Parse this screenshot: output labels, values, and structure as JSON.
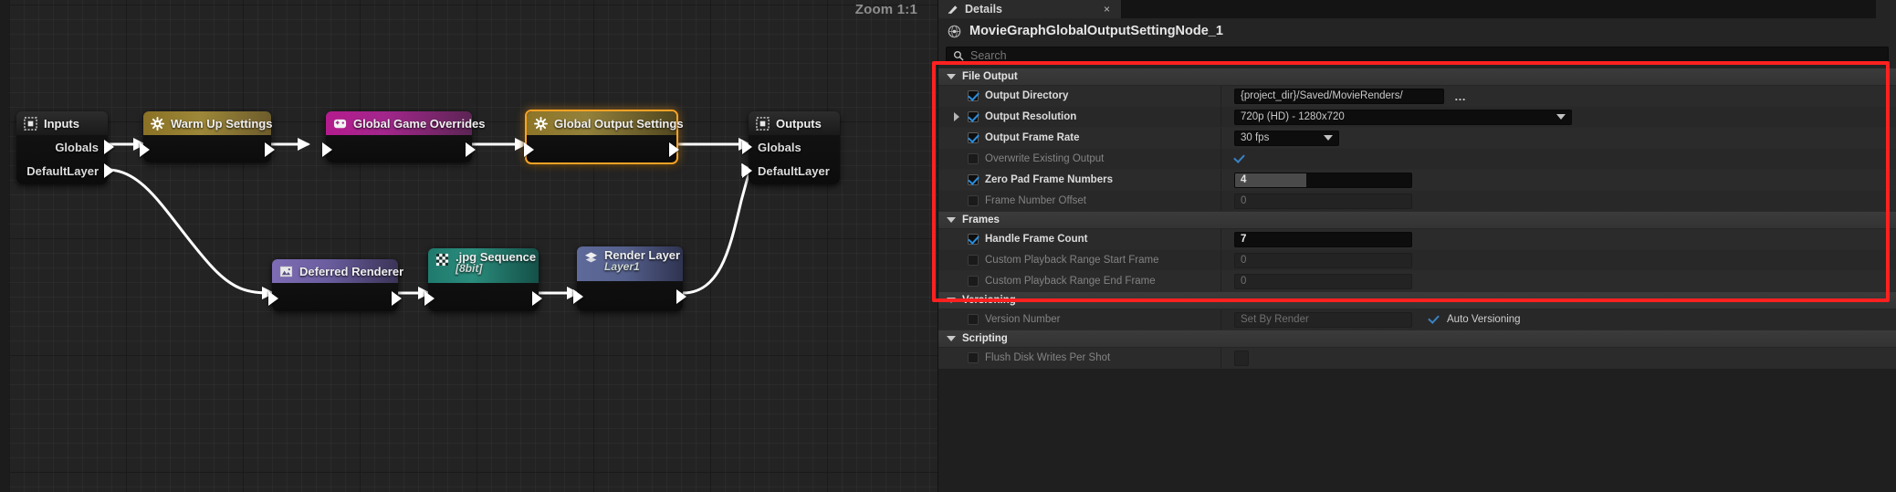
{
  "graph": {
    "zoom_label": "Zoom 1:1",
    "nodes": [
      {
        "id": "inputs",
        "title": "Inputs",
        "subtitle": "",
        "icon": "io-grid-icon",
        "pins": [
          "Globals",
          "DefaultLayer"
        ]
      },
      {
        "id": "warmup",
        "title": "Warm Up Settings",
        "subtitle": "",
        "icon": "gear-icon",
        "pins": []
      },
      {
        "id": "overrides",
        "title": "Global Game Overrides",
        "subtitle": "",
        "icon": "gamepad-icon",
        "pins": []
      },
      {
        "id": "globalout",
        "title": "Global Output Settings",
        "subtitle": "",
        "icon": "gear-icon",
        "pins": []
      },
      {
        "id": "outputs",
        "title": "Outputs",
        "subtitle": "",
        "icon": "io-grid-icon",
        "pins": [
          "Globals",
          "DefaultLayer"
        ]
      },
      {
        "id": "deferred",
        "title": "Deferred Renderer",
        "subtitle": "",
        "icon": "image-icon",
        "pins": []
      },
      {
        "id": "jpg",
        "title": ".jpg Sequence",
        "subtitle": "[8bit]",
        "icon": "checker-icon",
        "pins": []
      },
      {
        "id": "renderlayer",
        "title": "Render Layer",
        "subtitle": "Layer1",
        "icon": "layers-icon",
        "pins": []
      }
    ]
  },
  "panel": {
    "tab_label": "Details",
    "tab_icon": "details-icon",
    "close_label": "×",
    "object_name": "MovieGraphGlobalOutputSettingNode_1",
    "object_icon": "node-globe-icon",
    "search_icon": "search-icon",
    "search_placeholder": "Search",
    "highlight_color": "#ff2020",
    "accent_color": "#2a8fe0",
    "sections": [
      {
        "name": "File Output",
        "collapsed": false,
        "rows": [
          {
            "label": "Output Directory",
            "checked": true,
            "enabled": true,
            "expandable": false,
            "control": "path",
            "value": "{project_dir}/Saved/MovieRenders/",
            "aux": "…"
          },
          {
            "label": "Output Resolution",
            "checked": true,
            "enabled": true,
            "expandable": true,
            "control": "combo",
            "value": "720p (HD) - 1280x720"
          },
          {
            "label": "Output Frame Rate",
            "checked": true,
            "enabled": true,
            "expandable": false,
            "control": "combo-sm",
            "value": "30 fps"
          },
          {
            "label": "Overwrite Existing Output",
            "checked": false,
            "enabled": false,
            "expandable": false,
            "control": "inline-checkbox",
            "value_checked": true
          },
          {
            "label": "Zero Pad Frame Numbers",
            "checked": true,
            "enabled": true,
            "expandable": false,
            "control": "slider",
            "value": "4"
          },
          {
            "label": "Frame Number Offset",
            "checked": false,
            "enabled": false,
            "expandable": false,
            "control": "number",
            "value": "0"
          }
        ]
      },
      {
        "name": "Frames",
        "collapsed": false,
        "rows": [
          {
            "label": "Handle Frame Count",
            "checked": true,
            "enabled": true,
            "expandable": false,
            "control": "number",
            "value": "7"
          },
          {
            "label": "Custom Playback Range Start Frame",
            "checked": false,
            "enabled": false,
            "expandable": false,
            "control": "number",
            "value": "0"
          },
          {
            "label": "Custom Playback Range End Frame",
            "checked": false,
            "enabled": false,
            "expandable": false,
            "control": "number",
            "value": "0"
          }
        ]
      },
      {
        "name": "Versioning",
        "collapsed": false,
        "rows": [
          {
            "label": "Version Number",
            "checked": false,
            "enabled": false,
            "expandable": false,
            "control": "version",
            "value": "Set By Render",
            "aux_checkbox": true,
            "aux_label": "Auto Versioning"
          }
        ]
      },
      {
        "name": "Scripting",
        "collapsed": false,
        "rows": [
          {
            "label": "Flush Disk Writes Per Shot",
            "checked": false,
            "enabled": false,
            "expandable": false,
            "control": "tiny-checkbox",
            "value": ""
          }
        ]
      }
    ]
  }
}
